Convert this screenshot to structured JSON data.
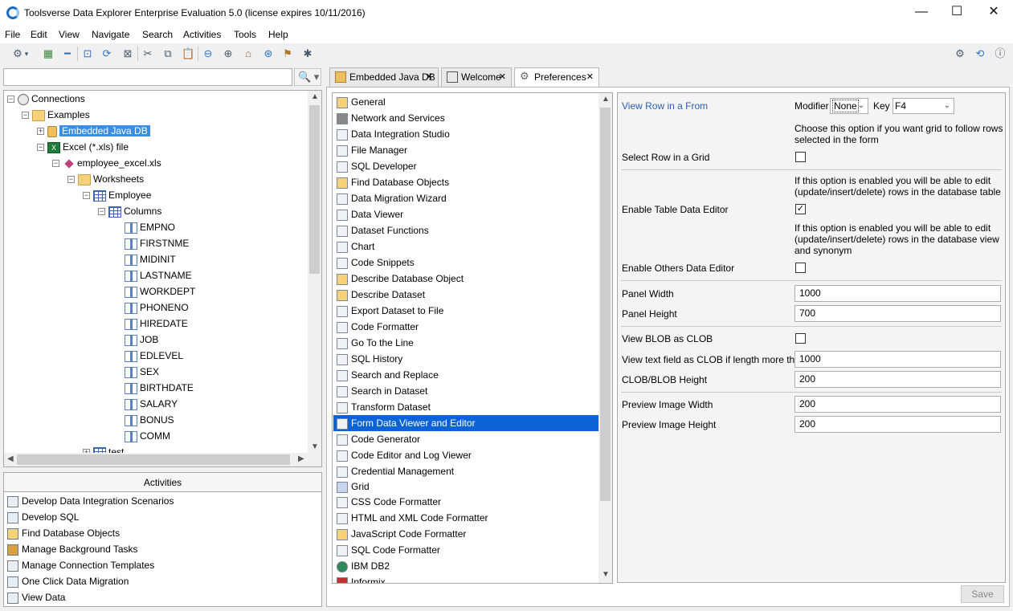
{
  "window": {
    "title": "Toolsverse Data Explorer Enterprise Evaluation 5.0 (license expires 10/11/2016)",
    "minimize": "—",
    "maximize": "☐",
    "close": "✕"
  },
  "menu": [
    "File",
    "Edit",
    "View",
    "Navigate",
    "Search",
    "Activities",
    "Tools",
    "Help"
  ],
  "search": {
    "value": "",
    "button": "🔍 ▾"
  },
  "tree": {
    "items": [
      "Connections",
      "Examples",
      "Embedded Java DB",
      "Excel (*.xls) file",
      "employee_excel.xls",
      "Worksheets",
      "Employee",
      "Columns",
      "EMPNO",
      "FIRSTNME",
      "MIDINIT",
      "LASTNAME",
      "WORKDEPT",
      "PHONENO",
      "HIREDATE",
      "JOB",
      "EDLEVEL",
      "SEX",
      "BIRTHDATE",
      "SALARY",
      "BONUS",
      "COMM",
      "test"
    ]
  },
  "activities": {
    "header": "Activities",
    "items": [
      "Develop Data Integration Scenarios",
      "Develop SQL",
      "Find Database Objects",
      "Manage Background Tasks",
      "Manage Connection Templates",
      "One Click Data Migration",
      "View Data"
    ]
  },
  "tabs": [
    {
      "label": "Embedded Java DB",
      "close": "✕"
    },
    {
      "label": "Welcome",
      "close": "✕"
    },
    {
      "label": "Preferences",
      "close": "✕"
    }
  ],
  "prefs": {
    "items": [
      "General",
      "Network and Services",
      "Data Integration Studio",
      "File Manager",
      "SQL Developer",
      "Find Database Objects",
      "Data Migration Wizard",
      "Data Viewer",
      "Dataset Functions",
      "Chart",
      "Code Snippets",
      "Describe Database Object",
      "Describe Dataset",
      "Export Dataset to File",
      "Code Formatter",
      "Go To the Line",
      "SQL History",
      "Search and Replace",
      "Search in Dataset",
      "Transform Dataset",
      "Form Data Viewer and Editor",
      "Code Generator",
      "Code Editor and Log Viewer",
      "Credential Management",
      "Grid",
      "CSS Code Formatter",
      "HTML and XML Code Formatter",
      "JavaScript Code Formatter",
      "SQL Code Formatter",
      "IBM DB2",
      "Informix"
    ],
    "selected_index": 20
  },
  "form": {
    "view_row_label": "View Row in a From",
    "modifier_label": "Modifier",
    "modifier_value": "None",
    "key_label": "Key",
    "key_value": "F4",
    "help_grid": "Choose this option if you want grid to follow rows selected in the form",
    "select_row_label": "Select Row in a Grid",
    "select_row_checked": false,
    "help_table_editor": "If this option is enabled you will be able to edit (update/insert/delete) rows in the database table",
    "enable_table_editor_label": "Enable Table Data Editor",
    "enable_table_editor_checked": true,
    "help_others_editor": "If this option is enabled you will be able to edit (update/insert/delete) rows in the database view and synonym",
    "enable_others_editor_label": "Enable Others Data Editor",
    "enable_others_editor_checked": false,
    "panel_width_label": "Panel Width",
    "panel_width": "1000",
    "panel_height_label": "Panel Height",
    "panel_height": "700",
    "view_blob_label": "View BLOB as CLOB",
    "view_blob_checked": false,
    "view_text_clob_label": "View text field as CLOB if length more than",
    "view_text_clob": "1000",
    "clob_height_label": "CLOB/BLOB Height",
    "clob_height": "200",
    "preview_width_label": "Preview Image Width",
    "preview_width": "200",
    "preview_height_label": "Preview Image Height",
    "preview_height": "200"
  },
  "save_label": "Save"
}
